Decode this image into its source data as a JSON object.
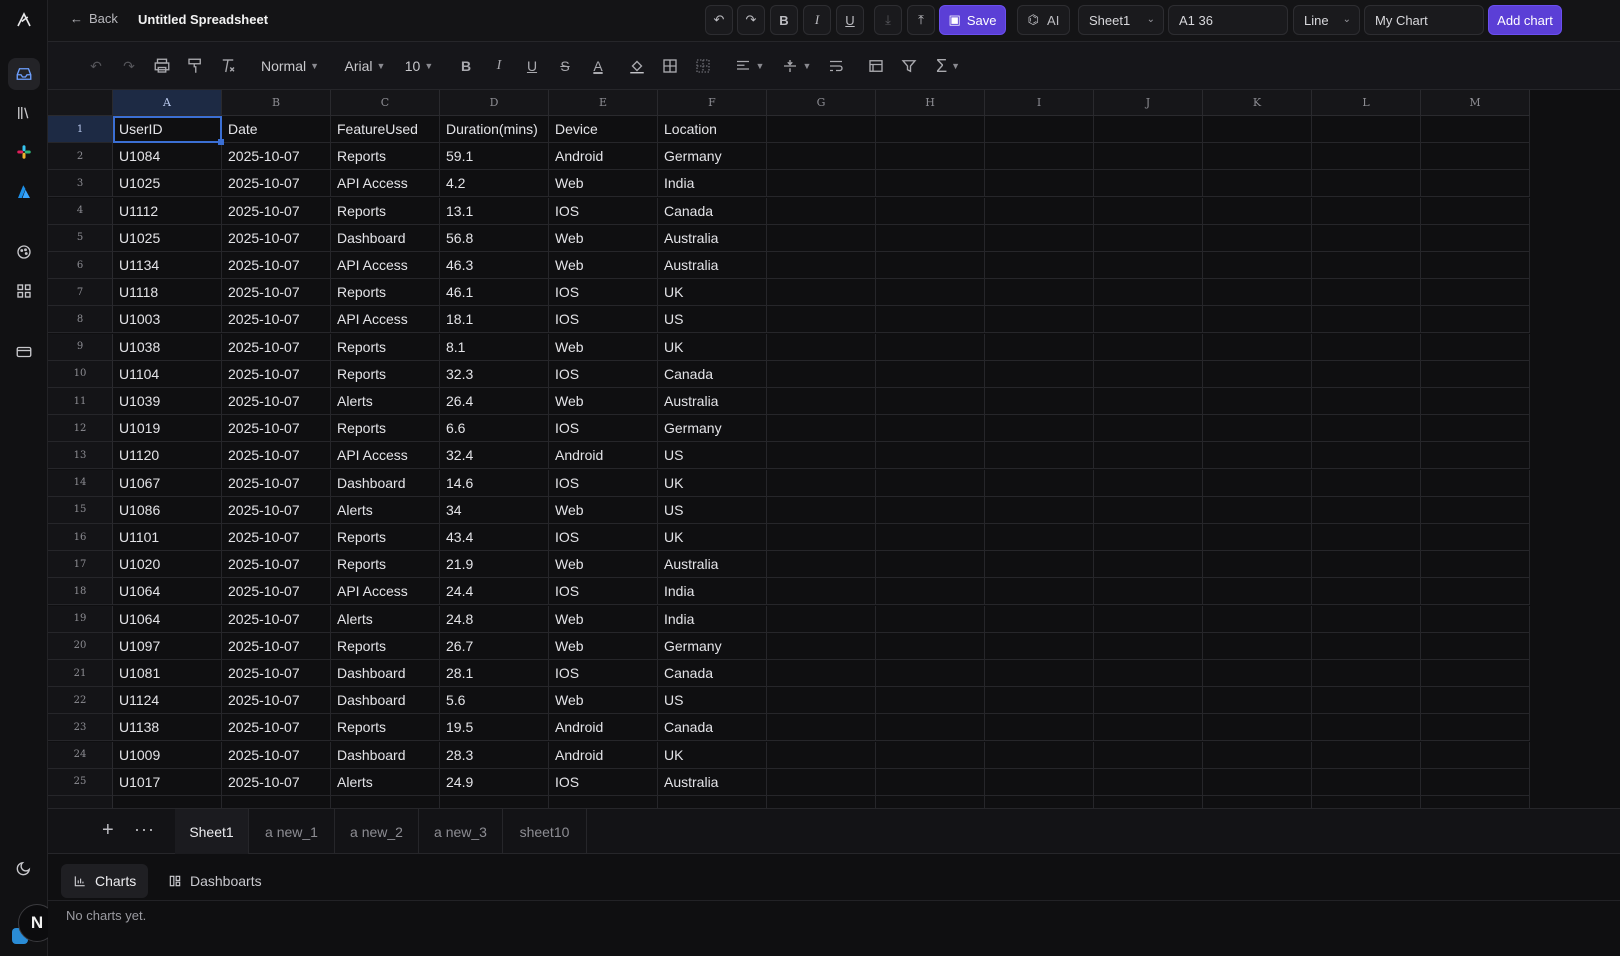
{
  "topbar": {
    "back_label": "Back",
    "title": "Untitled Spreadsheet",
    "buttons": {
      "bold": "B",
      "italic": "I",
      "underline": "U"
    },
    "save_label": "Save",
    "ai_label": "AI",
    "sheet_select": "Sheet1",
    "range_value": "A1 36",
    "chart_type": "Line",
    "chart_name": "My Chart",
    "add_chart_label": "Add chart"
  },
  "format": {
    "style": "Normal",
    "font": "Arial",
    "size": "10"
  },
  "columns": [
    "A",
    "B",
    "C",
    "D",
    "E",
    "F",
    "G",
    "H",
    "I",
    "J",
    "K",
    "L",
    "M"
  ],
  "selected_cell": "A1",
  "rows": [
    [
      "UserID",
      "Date",
      "FeatureUsed",
      "Duration(mins)",
      "Device",
      "Location"
    ],
    [
      "U1084",
      "2025-10-07",
      "Reports",
      "59.1",
      "Android",
      "Germany"
    ],
    [
      "U1025",
      "2025-10-07",
      "API Access",
      "4.2",
      "Web",
      "India"
    ],
    [
      "U1112",
      "2025-10-07",
      "Reports",
      "13.1",
      "IOS",
      "Canada"
    ],
    [
      "U1025",
      "2025-10-07",
      "Dashboard",
      "56.8",
      "Web",
      "Australia"
    ],
    [
      "U1134",
      "2025-10-07",
      "API Access",
      "46.3",
      "Web",
      "Australia"
    ],
    [
      "U1118",
      "2025-10-07",
      "Reports",
      "46.1",
      "IOS",
      "UK"
    ],
    [
      "U1003",
      "2025-10-07",
      "API Access",
      "18.1",
      "IOS",
      "US"
    ],
    [
      "U1038",
      "2025-10-07",
      "Reports",
      "8.1",
      "Web",
      "UK"
    ],
    [
      "U1104",
      "2025-10-07",
      "Reports",
      "32.3",
      "IOS",
      "Canada"
    ],
    [
      "U1039",
      "2025-10-07",
      "Alerts",
      "26.4",
      "Web",
      "Australia"
    ],
    [
      "U1019",
      "2025-10-07",
      "Reports",
      "6.6",
      "IOS",
      "Germany"
    ],
    [
      "U1120",
      "2025-10-07",
      "API Access",
      "32.4",
      "Android",
      "US"
    ],
    [
      "U1067",
      "2025-10-07",
      "Dashboard",
      "14.6",
      "IOS",
      "UK"
    ],
    [
      "U1086",
      "2025-10-07",
      "Alerts",
      "34",
      "Web",
      "US"
    ],
    [
      "U1101",
      "2025-10-07",
      "Reports",
      "43.4",
      "IOS",
      "UK"
    ],
    [
      "U1020",
      "2025-10-07",
      "Reports",
      "21.9",
      "Web",
      "Australia"
    ],
    [
      "U1064",
      "2025-10-07",
      "API Access",
      "24.4",
      "IOS",
      "India"
    ],
    [
      "U1064",
      "2025-10-07",
      "Alerts",
      "24.8",
      "Web",
      "India"
    ],
    [
      "U1097",
      "2025-10-07",
      "Reports",
      "26.7",
      "Web",
      "Germany"
    ],
    [
      "U1081",
      "2025-10-07",
      "Dashboard",
      "28.1",
      "IOS",
      "Canada"
    ],
    [
      "U1124",
      "2025-10-07",
      "Dashboard",
      "5.6",
      "Web",
      "US"
    ],
    [
      "U1138",
      "2025-10-07",
      "Reports",
      "19.5",
      "Android",
      "Canada"
    ],
    [
      "U1009",
      "2025-10-07",
      "Dashboard",
      "28.3",
      "Android",
      "UK"
    ],
    [
      "U1017",
      "2025-10-07",
      "Alerts",
      "24.9",
      "IOS",
      "Australia"
    ]
  ],
  "sheet_tabs": [
    "Sheet1",
    "a new_1",
    "a new_2",
    "a new_3",
    "sheet10"
  ],
  "active_sheet": "Sheet1",
  "bottom_panel": {
    "tabs": [
      "Charts",
      "Dashboarts"
    ],
    "empty_message": "No charts yet."
  },
  "user_initial": "N",
  "colors": {
    "accent": "#5b3fd6",
    "selection": "#3b6fd4"
  }
}
